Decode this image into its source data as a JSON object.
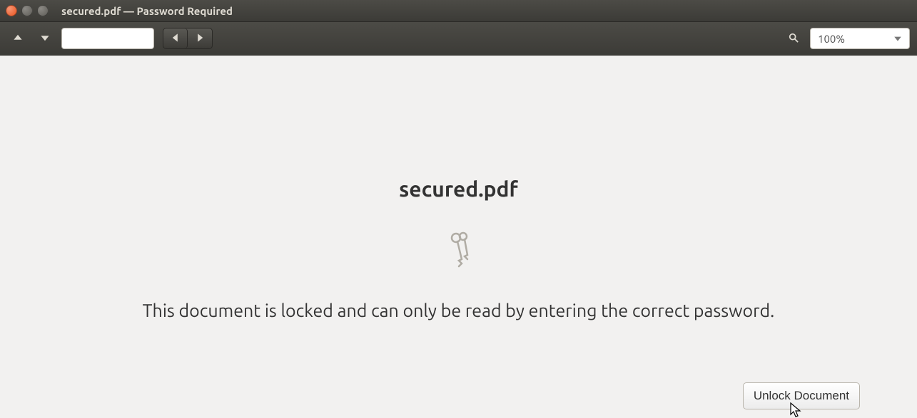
{
  "window": {
    "title": "secured.pdf — Password Required"
  },
  "toolbar": {
    "page_value": "",
    "zoom_value": "100%"
  },
  "content": {
    "doc_title": "secured.pdf",
    "lock_message": "This document is locked and can only be read by entering the correct password.",
    "unlock_button_label": "Unlock Document"
  },
  "icons": {
    "close": "close-icon",
    "minimize": "minimize-icon",
    "maximize": "maximize-icon",
    "prev_page": "chevron-up-icon",
    "next_page": "chevron-down-icon",
    "history_back": "chevron-left-icon",
    "history_forward": "chevron-right-icon",
    "search": "search-icon",
    "dropdown": "chevron-down-icon",
    "keys": "keys-icon"
  }
}
